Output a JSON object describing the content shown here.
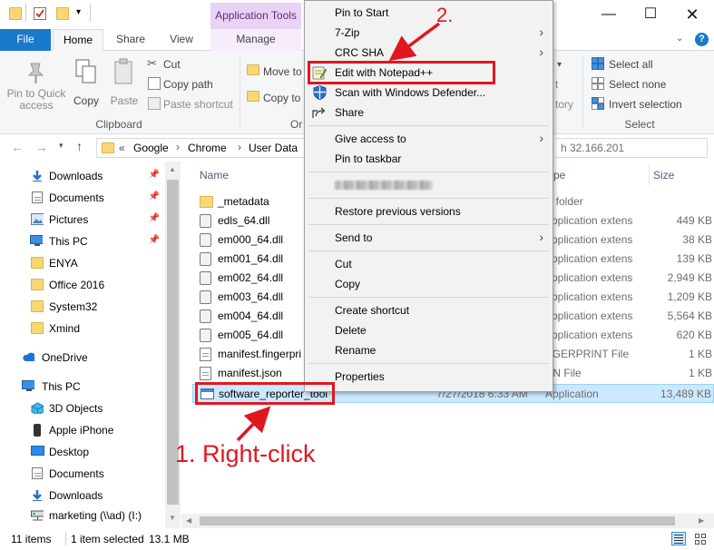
{
  "titlebar": {
    "app_tools_label": "Application Tools",
    "window_buttons": [
      "minimize-icon",
      "maximize-icon",
      "close-icon"
    ]
  },
  "ribbon": {
    "tabs": [
      "File",
      "Home",
      "Share",
      "View",
      "Manage"
    ],
    "clipboard": {
      "pin_quick_access": "Pin to Quick access",
      "copy": "Copy",
      "paste": "Paste",
      "cut": "Cut",
      "copy_path": "Copy path",
      "paste_shortcut": "Paste shortcut",
      "group_label": "Clipboard"
    },
    "organize": {
      "move_to": "Move to",
      "copy_to": "Copy to",
      "group_label_partial": "Or"
    },
    "select": {
      "select_all": "Select all",
      "select_none": "Select none",
      "invert_selection": "Invert selection",
      "group_label": "Select"
    },
    "partial_labels": [
      "t",
      "tory"
    ]
  },
  "address": {
    "overflow": "«",
    "crumbs": [
      "Google",
      "Chrome",
      "User Data"
    ],
    "search_partial": "h 32.166.201"
  },
  "nav": {
    "items": [
      {
        "label": "Downloads",
        "icon": "download-icon",
        "pinned": true
      },
      {
        "label": "Documents",
        "icon": "documents-icon",
        "pinned": true
      },
      {
        "label": "Pictures",
        "icon": "pictures-icon",
        "pinned": true
      },
      {
        "label": "This PC",
        "icon": "this-pc-icon",
        "pinned": true
      },
      {
        "label": "ENYA",
        "icon": "folder-icon",
        "pinned": false
      },
      {
        "label": "Office 2016",
        "icon": "folder-icon",
        "pinned": false
      },
      {
        "label": "System32",
        "icon": "folder-icon",
        "pinned": false
      },
      {
        "label": "Xmind",
        "icon": "folder-icon",
        "pinned": false
      },
      {
        "label": "OneDrive",
        "icon": "cloud-icon",
        "pinned": false
      },
      {
        "label": "This PC",
        "icon": "this-pc-icon",
        "pinned": false
      },
      {
        "label": "3D Objects",
        "icon": "3d-objects-icon",
        "pinned": false
      },
      {
        "label": "Apple iPhone",
        "icon": "phone-icon",
        "pinned": false
      },
      {
        "label": "Desktop",
        "icon": "desktop-icon",
        "pinned": false
      },
      {
        "label": "Documents",
        "icon": "documents-icon",
        "pinned": false
      },
      {
        "label": "Downloads",
        "icon": "download-icon",
        "pinned": false
      },
      {
        "label": "marketing (\\\\ad) (I:)",
        "icon": "network-drive-icon",
        "pinned": false
      }
    ]
  },
  "files": {
    "columns": {
      "name": "Name",
      "type_partial": "pe",
      "size": "Size"
    },
    "rows": [
      {
        "name": "_metadata",
        "date": "",
        "type": "le folder",
        "size": "",
        "icon": "folder-icon"
      },
      {
        "name": "edls_64.dll",
        "date": "",
        "type": "Application extens",
        "size": "449 KB",
        "icon": "dll-icon"
      },
      {
        "name": "em000_64.dll",
        "date": "",
        "type": "Application extens",
        "size": "38 KB",
        "icon": "dll-icon"
      },
      {
        "name": "em001_64.dll",
        "date": "",
        "type": "Application extens",
        "size": "139 KB",
        "icon": "dll-icon"
      },
      {
        "name": "em002_64.dll",
        "date": "",
        "type": "Application extens",
        "size": "2,949 KB",
        "icon": "dll-icon"
      },
      {
        "name": "em003_64.dll",
        "date": "",
        "type": "Application extens",
        "size": "1,209 KB",
        "icon": "dll-icon"
      },
      {
        "name": "em004_64.dll",
        "date": "",
        "type": "Application extens",
        "size": "5,564 KB",
        "icon": "dll-icon"
      },
      {
        "name": "em005_64.dll",
        "date": "",
        "type": "Application extens",
        "size": "620 KB",
        "icon": "dll-icon"
      },
      {
        "name": "manifest.fingerpri",
        "date": "",
        "type": "NGERPRINT File",
        "size": "1 KB",
        "icon": "file-icon"
      },
      {
        "name": "manifest.json",
        "date": "",
        "type": "ON File",
        "size": "1 KB",
        "icon": "file-icon"
      },
      {
        "name": "software_reporter_tool",
        "date": "7/27/2018 6:33 AM",
        "type": "Application",
        "size": "13,489 KB",
        "icon": "application-icon"
      }
    ]
  },
  "context_menu": {
    "items": [
      {
        "label": "Pin to Start",
        "icon": "",
        "submenu": false
      },
      {
        "label": "7-Zip",
        "icon": "",
        "submenu": true
      },
      {
        "label": "CRC SHA",
        "icon": "",
        "submenu": true
      },
      {
        "label": "Edit with Notepad++",
        "icon": "notepad-plus-plus-icon",
        "submenu": false
      },
      {
        "label": "Scan with Windows Defender...",
        "icon": "windows-defender-icon",
        "submenu": false
      },
      {
        "label": "Share",
        "icon": "share-icon",
        "submenu": false
      },
      {
        "label": "Give access to",
        "icon": "",
        "submenu": true
      },
      {
        "label": "Pin to taskbar",
        "icon": "",
        "submenu": false
      },
      {
        "label": "",
        "icon": "",
        "submenu": false,
        "blurred": true
      },
      {
        "label": "Restore previous versions",
        "icon": "",
        "submenu": false
      },
      {
        "label": "Send to",
        "icon": "",
        "submenu": true
      },
      {
        "label": "Cut",
        "icon": "",
        "submenu": false
      },
      {
        "label": "Copy",
        "icon": "",
        "submenu": false
      },
      {
        "label": "Create shortcut",
        "icon": "",
        "submenu": false
      },
      {
        "label": "Delete",
        "icon": "",
        "submenu": false
      },
      {
        "label": "Rename",
        "icon": "",
        "submenu": false
      },
      {
        "label": "Properties",
        "icon": "",
        "submenu": false
      }
    ]
  },
  "annotations": {
    "step1": "1. Right-click",
    "step2": "2.",
    "color": "#e0171f"
  },
  "status": {
    "items_count": "11 items",
    "selected": "1 item selected",
    "selected_size": "13.1 MB"
  },
  "colors": {
    "accent": "#1979ca",
    "app_tools": "#e9d3f5",
    "selection": "#cce8ff"
  }
}
